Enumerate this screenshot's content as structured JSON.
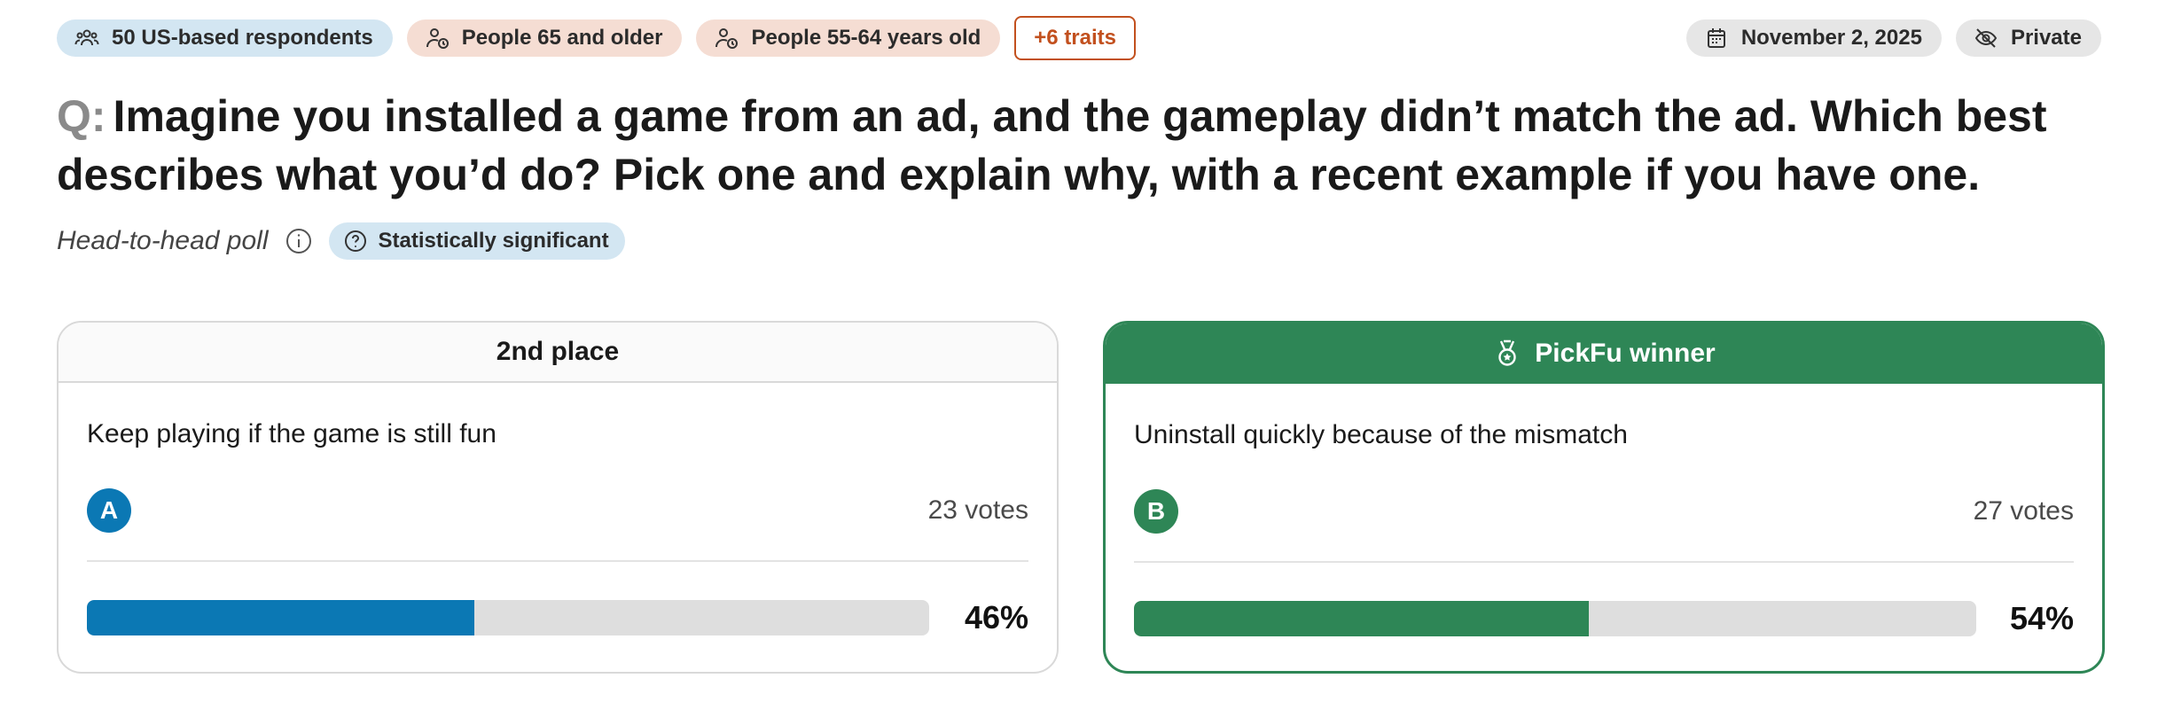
{
  "tags": {
    "respondents": "50 US-based respondents",
    "trait1": "People 65 and older",
    "trait2": "People 55-64 years old",
    "more_traits": "+6 traits",
    "date": "November 2, 2025",
    "privacy": "Private"
  },
  "question": {
    "prefix": "Q:",
    "text": "Imagine you installed a game from an ad, and the gameplay didn’t match the ad. Which best describes what you’d do? Pick one and explain why, with a recent example if you have one."
  },
  "meta": {
    "poll_type": "Head-to-head poll",
    "significance": "Statistically significant"
  },
  "options": [
    {
      "header": "2nd place",
      "text": "Keep playing if the game is still fun",
      "letter": "A",
      "votes": "23 votes",
      "percent_label": "46%",
      "percent": 46,
      "color": "#0b78b4"
    },
    {
      "header": "PickFu winner",
      "text": "Uninstall quickly because of the mismatch",
      "letter": "B",
      "votes": "27 votes",
      "percent_label": "54%",
      "percent": 54,
      "color": "#2e8656"
    }
  ],
  "icons": {
    "respondents": "people-group-icon",
    "trait": "person-clock-icon",
    "date": "calendar-icon",
    "privacy": "eye-slash-icon",
    "info": "info-icon",
    "significance": "question-circle-icon",
    "winner": "medal-icon"
  }
}
